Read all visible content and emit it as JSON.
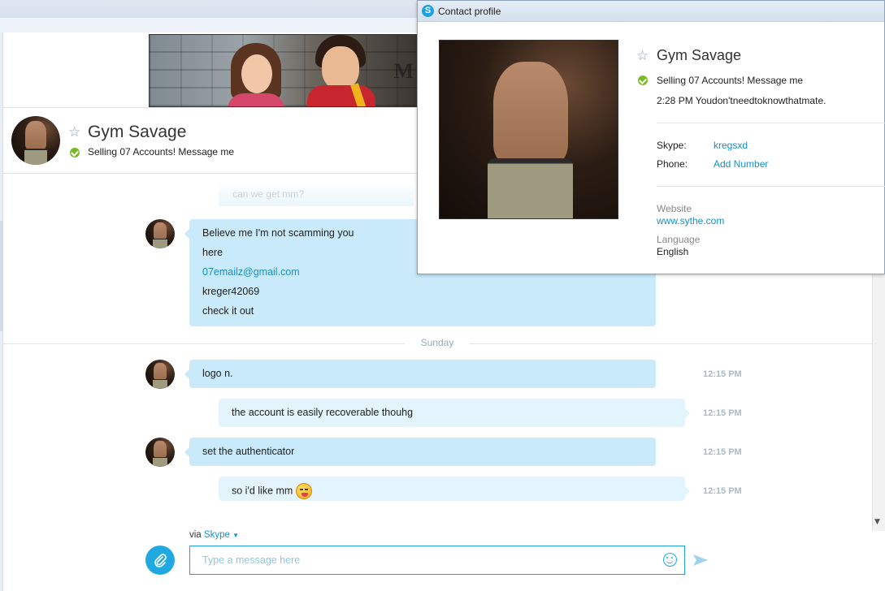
{
  "header": {
    "contact_name": "Gym Savage",
    "status": "Selling 07 Accounts! Message me"
  },
  "messages": {
    "faded_previous": "can we get mm?",
    "block1": {
      "lines": [
        "Believe me I'm not scamming you",
        "here",
        "07emailz@gmail.com",
        "kreger42069",
        "check it out"
      ]
    },
    "day_divider": "Sunday",
    "m1": {
      "text": "logo n.",
      "time": "12:15 PM"
    },
    "m2": {
      "text": "the account is easily recoverable thouhg",
      "time": "12:15 PM"
    },
    "m3": {
      "text": "set the authenticator",
      "time": "12:15 PM"
    },
    "m4": {
      "text": "so i'd like mm",
      "time": "12:15 PM",
      "emoji": "tongue-out-emoji"
    }
  },
  "compose": {
    "via_label": "via",
    "via_service": "Skype",
    "placeholder": "Type a message here"
  },
  "profile": {
    "window_title": "Contact profile",
    "name": "Gym Savage",
    "status": "Selling 07 Accounts! Message me",
    "last_message": "2:28 PM Youdon'tneedtoknowthatmate.",
    "skype_label": "Skype:",
    "skype_value": "kregsxd",
    "phone_label": "Phone:",
    "phone_value": "Add Number",
    "website_label": "Website",
    "website_value": "www.sythe.com",
    "language_label": "Language",
    "language_value": "English"
  },
  "colors": {
    "accent": "#20a9e1",
    "bubble_incoming": "#c8eafa",
    "bubble_outgoing": "#e3f4fc",
    "status_online": "#7ab929",
    "link": "#1391c8"
  }
}
